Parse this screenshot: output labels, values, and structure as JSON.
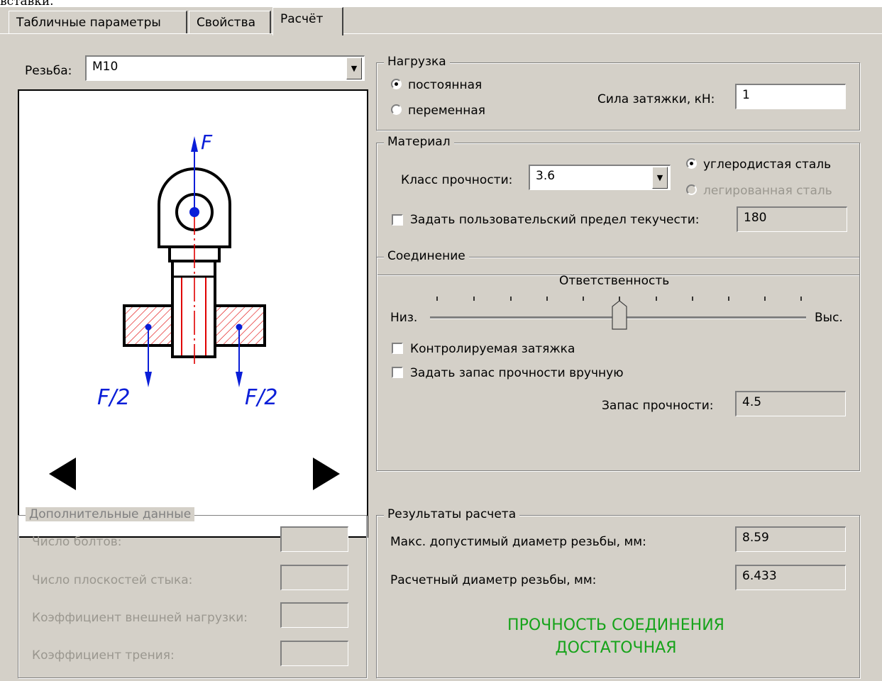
{
  "top_cut_text": "вставки.",
  "tabs": [
    {
      "label": "Табличные параметры"
    },
    {
      "label": "Свойства"
    },
    {
      "label": "Расчёт"
    }
  ],
  "thread": {
    "label": "Резьба:",
    "value": "M10"
  },
  "diagram": {
    "force_top": "F",
    "force_left": "F/2",
    "force_right": "F/2"
  },
  "load": {
    "title": "Нагрузка",
    "option_constant": "постоянная",
    "option_variable": "переменная",
    "selected": "постоянная",
    "tightening_label": "Сила затяжки, кН:",
    "tightening_value": "1"
  },
  "material": {
    "title": "Материал",
    "class_label": "Класс прочности:",
    "class_value": "3.6",
    "option_carbon": "углеродистая сталь",
    "option_alloy": "легированная сталь",
    "selected": "углеродистая сталь",
    "custom_yield_label": "Задать пользовательский предел текучести:",
    "custom_yield_value": "180"
  },
  "connection": {
    "title": "Соединение",
    "responsibility_label": "Ответственность",
    "low_label": "Низ.",
    "high_label": "Выс.",
    "slider_position": 0.5,
    "controlled_tightening_label": "Контролируемая затяжка",
    "manual_safety_label": "Задать запас прочности вручную",
    "safety_factor_label": "Запас прочности:",
    "safety_factor_value": "4.5"
  },
  "extra": {
    "title": "Дополнительные данные",
    "bolts_label": "Число болтов:",
    "planes_label": "Число плоскостей стыка:",
    "ext_load_coef_label": "Коэффициент внешней нагрузки:",
    "friction_coef_label": "Коэффициент трения:"
  },
  "results": {
    "title": "Результаты расчета",
    "max_diameter_label": "Макс. допустимый диаметр резьбы, мм:",
    "max_diameter_value": "8.59",
    "calc_diameter_label": "Расчетный диаметр резьбы, мм:",
    "calc_diameter_value": "6.433",
    "verdict_line1": "ПРОЧНОСТЬ СОЕДИНЕНИЯ",
    "verdict_line2": "ДОСТАТОЧНАЯ"
  },
  "colors": {
    "face": "#d4d0c8",
    "verdict": "#16a31a",
    "force": "#0a1ed8",
    "axis": "#e00000"
  }
}
